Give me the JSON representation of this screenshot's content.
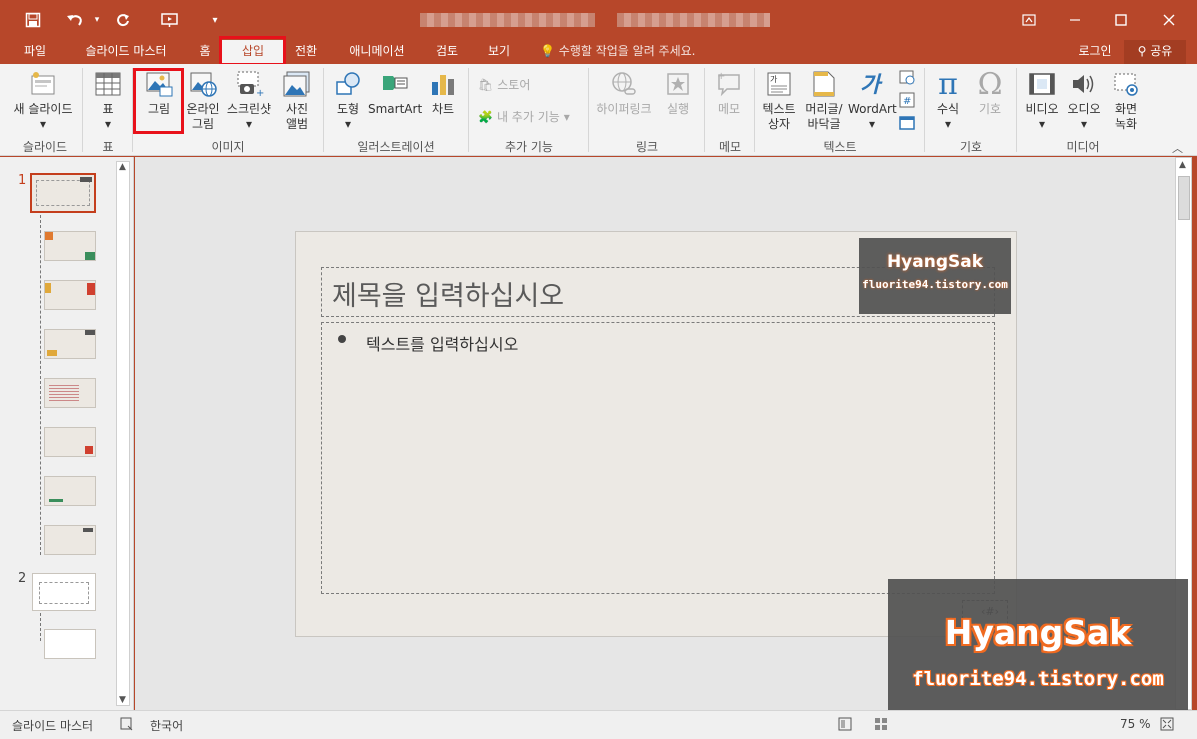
{
  "title_bar": {
    "quick_access": [
      "save-icon",
      "undo-icon",
      "redo-icon",
      "slideshow-from-start-icon",
      "customize-qat-icon"
    ],
    "window_controls": [
      "ribbon-display-icon",
      "minimize-icon",
      "maximize-icon",
      "close-icon"
    ]
  },
  "tabs": [
    "파일",
    "슬라이드 마스터",
    "홈",
    "삽입",
    "전환",
    "애니메이션",
    "검토",
    "보기"
  ],
  "active_tab": "삽입",
  "tell_me": "수행할 작업을 알려 주세요.",
  "account": {
    "login": "로그인",
    "share": "공유"
  },
  "ribbon": {
    "new_slide": "새 슬라이드",
    "table": "표",
    "picture": "그림",
    "online_picture": "온라인 그림",
    "screenshot": "스크린샷",
    "photo_album": "사진 앨범",
    "shapes": "도형",
    "smartart": "SmartArt",
    "chart": "차트",
    "store": "스토어",
    "my_addins": "내 추가 기능",
    "hyperlink": "하이퍼링크",
    "action": "실행",
    "comment": "메모",
    "textbox": "텍스트 상자",
    "header_footer": "머리글/ 바닥글",
    "wordart": "WordArt",
    "equation": "수식",
    "symbol": "기호",
    "video": "비디오",
    "audio": "오디오",
    "screen_recording": "화면 녹화",
    "groups": [
      "슬라이드",
      "표",
      "이미지",
      "일러스트레이션",
      "추가 기능",
      "링크",
      "메모",
      "텍스트",
      "기호",
      "미디어"
    ]
  },
  "thumbnails": {
    "numbers": [
      "1",
      "2"
    ]
  },
  "slide": {
    "title_placeholder": "제목을 입력하십시오",
    "body_placeholder": "텍스트를 입력하십시오"
  },
  "watermark": {
    "name": "HyangSak",
    "site": "fluorite94.tistory.com"
  },
  "status": {
    "view": "슬라이드 마스터",
    "language": "한국어",
    "zoom": "75 %"
  }
}
